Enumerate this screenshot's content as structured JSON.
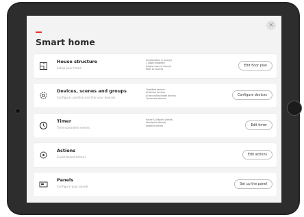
{
  "page": {
    "title": "Smart home",
    "close_label": "×"
  },
  "cards": [
    {
      "name": "House structure",
      "desc": "Setup your home",
      "details": [
        "Configuration in room(s)",
        "1 stage (between)",
        "Subject room in room(s)",
        "Refer to sources"
      ],
      "action": "Edit floor plan",
      "icon": "floor-plan-icon"
    },
    {
      "name": "Devices, scenes and groups",
      "desc": "Configure, position and link your devices",
      "details": [
        "Classified devices",
        "All similar devices",
        "All secondary/linked devices",
        "Connected devices"
      ],
      "action": "Configure devices",
      "icon": "gear-icon"
    },
    {
      "name": "Timer",
      "desc": "Time-controlled events",
      "details": [
        "House & Setpoint (timed)",
        "Standpoint (timed)",
        "Weather (timed)"
      ],
      "action": "Edit timer",
      "icon": "clock-icon"
    },
    {
      "name": "Actions",
      "desc": "Event-based actions",
      "details": [],
      "action": "Edit actions",
      "icon": "actions-icon"
    },
    {
      "name": "Panels",
      "desc": "Configure your panels",
      "details": [],
      "action": "Set up the panel",
      "icon": "panel-icon"
    }
  ],
  "colors": {
    "accent": "#e3312d",
    "device_frame": "#232323",
    "screen_background": "#f3f3f3"
  }
}
